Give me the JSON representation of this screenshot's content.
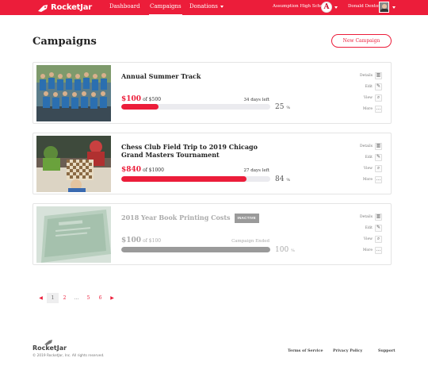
{
  "app": {
    "brand": "RocketJar"
  },
  "nav": {
    "links": [
      {
        "label": "Dashboard",
        "active": false
      },
      {
        "label": "Campaigns",
        "active": true
      },
      {
        "label": "Donations",
        "active": false
      }
    ],
    "school_name": "Assumption High School",
    "school_badge_letter": "A",
    "user_name": "Donald Denton"
  },
  "page": {
    "title": "Campaigns",
    "new_button_label": "New Campaign"
  },
  "action_labels": {
    "details": "Details",
    "edit": "Edit",
    "view": "View",
    "more": "More"
  },
  "campaigns": [
    {
      "title": "Annual Summer Track",
      "raised": "$100",
      "goal": "of $500",
      "status_text": "34 days left",
      "percent": "25",
      "percent_sign": "%",
      "progress": 0.25,
      "inactive": false,
      "badge": ""
    },
    {
      "title": "Chess Club Field Trip to 2019 Chicago Grand Masters Tournament",
      "raised": "$840",
      "goal": "of $1000",
      "status_text": "27 days left",
      "percent": "84",
      "percent_sign": "%",
      "progress": 0.84,
      "inactive": false,
      "badge": ""
    },
    {
      "title": "2018 Year Book Printing Costs",
      "raised": "$100",
      "goal": "of $100",
      "status_text": "Campaign Ended",
      "percent": "100",
      "percent_sign": "%",
      "progress": 1.0,
      "inactive": true,
      "badge": "INACTIVE"
    }
  ],
  "pagination": {
    "prev": "◀",
    "pages": [
      "1",
      "2",
      "…",
      "5",
      "6"
    ],
    "current": "1",
    "next": "▶"
  },
  "footer": {
    "brand": "RocketJar",
    "copyright": "© 2019 RocketJar, Inc. All rights reserved.",
    "links": [
      "Terms of Service",
      "Privacy Policy",
      "Support"
    ]
  },
  "colors": {
    "accent": "#ec1d3a",
    "inactive": "#9a9a9a",
    "track": "#ebebef"
  },
  "icons": {
    "details": "chart-icon",
    "edit": "pencil-icon",
    "view": "magnifier-icon",
    "more": "ellipsis-icon"
  }
}
